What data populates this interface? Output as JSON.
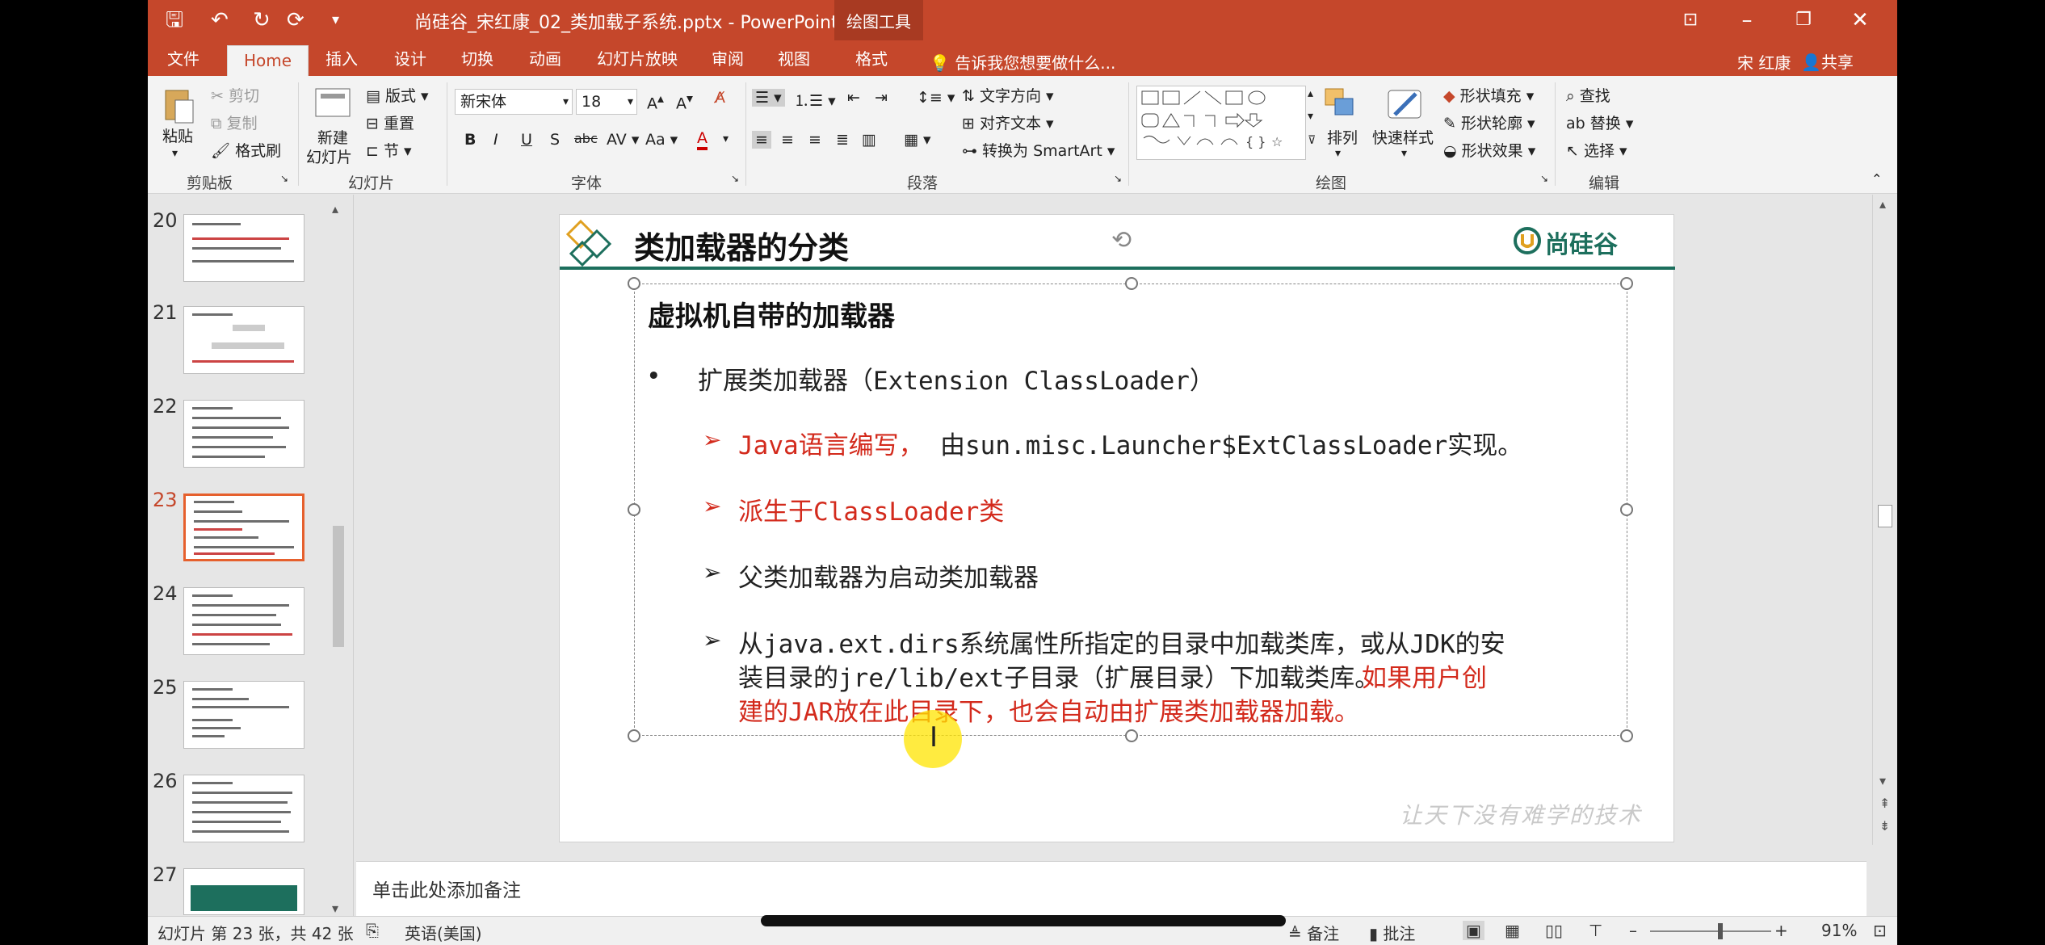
{
  "window": {
    "title": "尚硅谷_宋红康_02_类加载子系统.pptx - PowerPoint",
    "context_tool": "绘图工具"
  },
  "tabs": [
    "文件",
    "Home",
    "插入",
    "设计",
    "切换",
    "动画",
    "幻灯片放映",
    "审阅",
    "视图",
    "格式"
  ],
  "tellme": "告诉我您想要做什么...",
  "user": "宋 红康",
  "share": "共享",
  "ribbon": {
    "paste": "粘贴",
    "cut": "剪切",
    "copy": "复制",
    "format_painter": "格式刷",
    "clipboard_group": "剪贴板",
    "new_slide_1": "新建",
    "new_slide_2": "幻灯片",
    "layout": "版式",
    "reset": "重置",
    "section": "节",
    "slides_group": "幻灯片",
    "font_name": "新宋体",
    "font_size": "18",
    "font_group": "字体",
    "text_direction": "文字方向",
    "align_text": "对齐文本",
    "convert_smartart": "转换为 SmartArt",
    "paragraph_group": "段落",
    "arrange": "排列",
    "quick_styles": "快速样式",
    "shape_fill": "形状填充",
    "shape_outline": "形状轮廓",
    "shape_effects": "形状效果",
    "drawing_group": "绘图",
    "find": "查找",
    "replace": "替换",
    "select": "选择",
    "editing_group": "编辑"
  },
  "thumbnails": [
    {
      "num": "20",
      "selected": false
    },
    {
      "num": "21",
      "selected": false
    },
    {
      "num": "22",
      "selected": false
    },
    {
      "num": "23",
      "selected": true
    },
    {
      "num": "24",
      "selected": false
    },
    {
      "num": "25",
      "selected": false
    },
    {
      "num": "26",
      "selected": false
    },
    {
      "num": "27",
      "selected": false
    }
  ],
  "slide": {
    "title": "类加载器的分类",
    "logo_text": "尚硅谷",
    "box_heading": "虚拟机自带的加载器",
    "bullet": "•",
    "bullet_text": "扩展类加载器（Extension ClassLoader）",
    "arrow": "➢",
    "item1": "Java语言编写，",
    "item1_rest": "由sun.misc.Launcher$ExtClassLoader实现。",
    "item2": "派生于ClassLoader类",
    "item3": "父类加载器为启动类加载器",
    "item4_line1": "从java.ext.dirs系统属性所指定的目录中加载类库，或从JDK的安",
    "item4_line2a": "装目录的jre/lib/ext子目录（扩展目录）下加载类库。",
    "item4_line2b": "如果用户创",
    "item4_line3": "建的JAR放在此目录下，也会自动由扩展类加载器加载。",
    "watermark": "让天下没有难学的技术"
  },
  "notes_placeholder": "单击此处添加备注",
  "status": {
    "slide_info": "幻灯片 第 23 张，共 42 张",
    "language": "英语(美国)",
    "notes": "备注",
    "comments": "批注",
    "zoom": "91%"
  },
  "colors": {
    "accent": "#c5472b",
    "slide_rule": "#1d6f5d",
    "red_text": "#d32a1c",
    "selected_thumb": "#e6602d"
  }
}
